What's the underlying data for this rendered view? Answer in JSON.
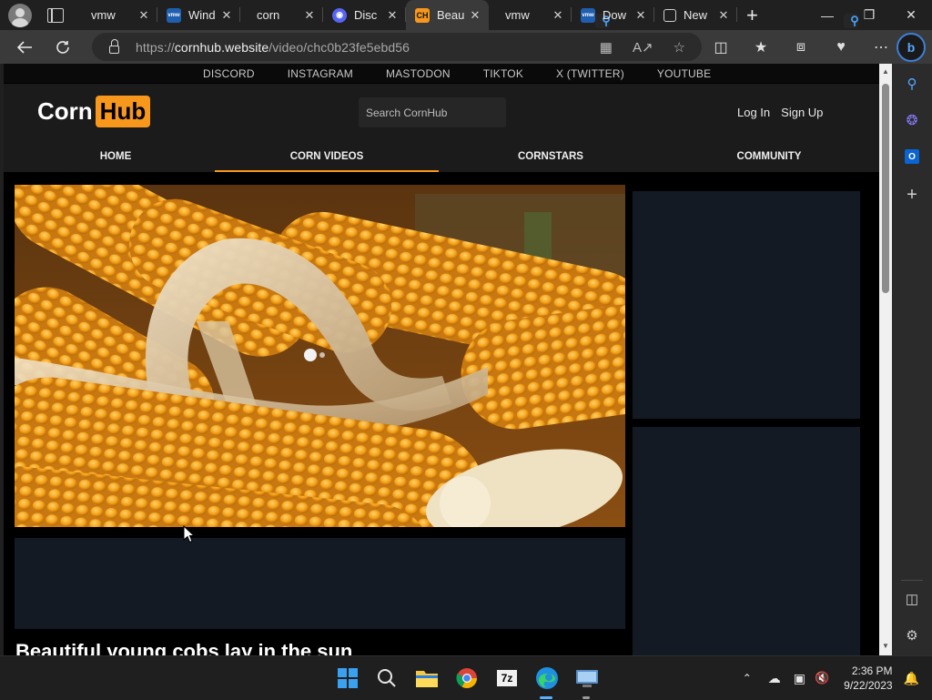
{
  "browser": {
    "tabs": [
      {
        "title": "vmw",
        "icon": "search-icon",
        "kind": "search"
      },
      {
        "title": "Wind",
        "icon": "vmware-icon",
        "kind": "vmw"
      },
      {
        "title": "corn",
        "icon": "search-icon",
        "kind": "search"
      },
      {
        "title": "Disc",
        "icon": "discord-icon",
        "kind": "discord"
      },
      {
        "title": "Beau",
        "icon": "cornhub-icon",
        "kind": "ch",
        "active": true
      },
      {
        "title": "vmw",
        "icon": "search-icon",
        "kind": "search"
      },
      {
        "title": "Dow",
        "icon": "vmware-icon",
        "kind": "vmw"
      },
      {
        "title": "New",
        "icon": "newtab-page-icon",
        "kind": "page"
      }
    ],
    "url_prefix": "https://",
    "url_host": "cornhub.website",
    "url_path": "/video/chc0b23fe5ebd56"
  },
  "site": {
    "social_links": [
      "DISCORD",
      "INSTAGRAM",
      "MASTODON",
      "TIKTOK",
      "X (TWITTER)",
      "YOUTUBE"
    ],
    "logo_part1": "Corn",
    "logo_part2": "Hub",
    "search_placeholder": "Search CornHub",
    "login_label": "Log In",
    "signup_label": "Sign Up",
    "nav": [
      {
        "label": "HOME",
        "active": false
      },
      {
        "label": "CORN VIDEOS",
        "active": true
      },
      {
        "label": "CORNSTARS",
        "active": false
      },
      {
        "label": "COMMUNITY",
        "active": false
      }
    ],
    "video_title": "Beautiful young cobs lay in the sun"
  },
  "taskbar": {
    "time": "2:36 PM",
    "date": "9/22/2023"
  },
  "colors": {
    "accent": "#f7971c",
    "panel": "#141a24",
    "header": "#1b1b1b"
  }
}
